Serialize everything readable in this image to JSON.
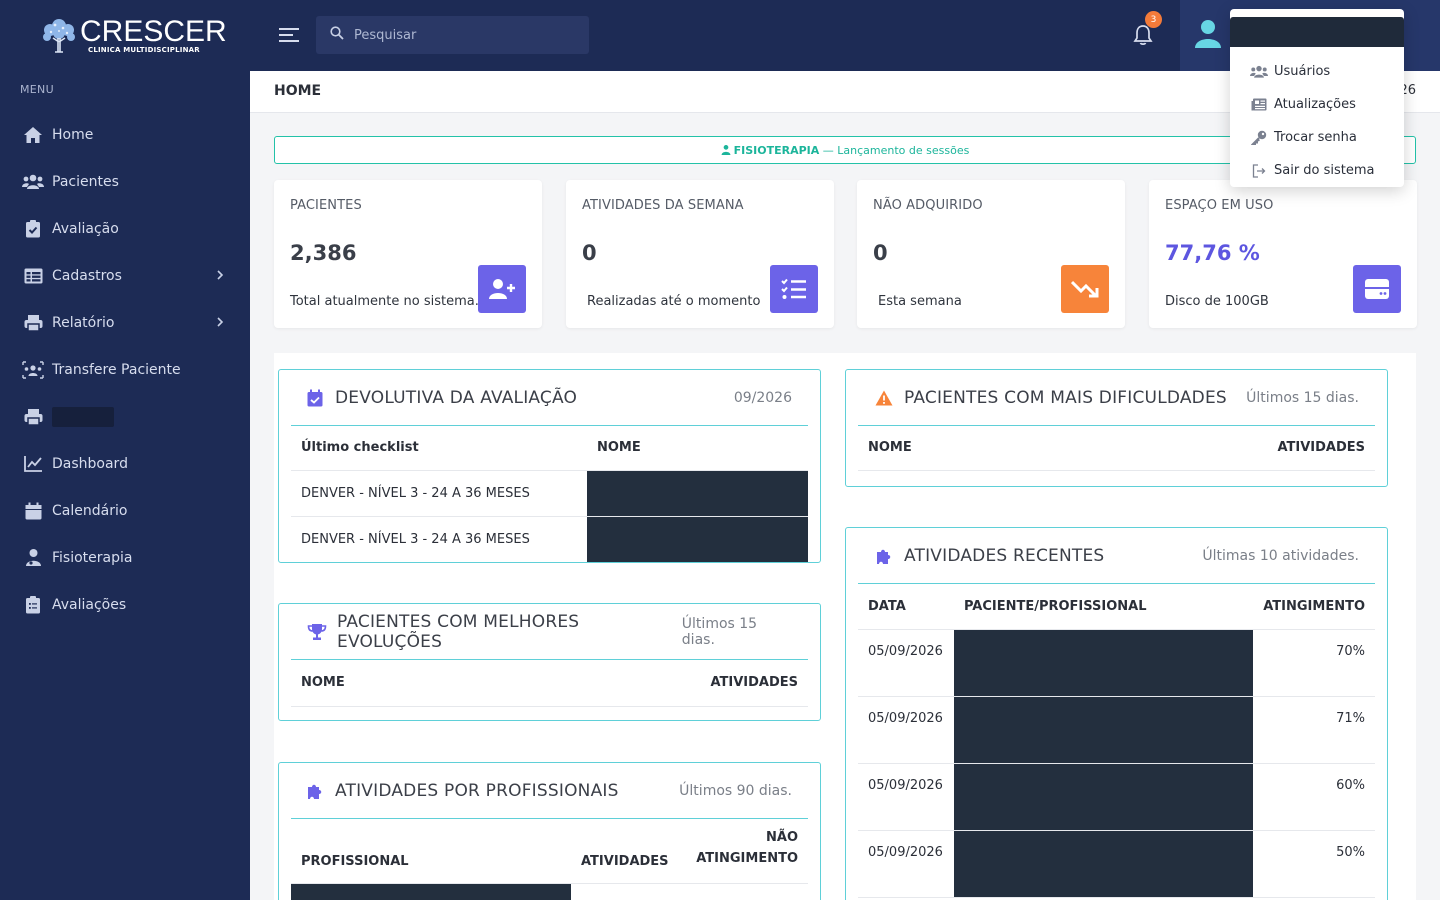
{
  "brand": {
    "name": "CRESCER",
    "subtitle": "CLINICA MULTIDISCIPLINAR"
  },
  "sidebar": {
    "menu_title": "MENU",
    "items": [
      {
        "label": "Home",
        "icon": "home-icon"
      },
      {
        "label": "Pacientes",
        "icon": "users-icon"
      },
      {
        "label": "Avaliação",
        "icon": "clipboard-check-icon"
      },
      {
        "label": "Cadastros",
        "icon": "table-icon",
        "has_submenu": true
      },
      {
        "label": "Relatório",
        "icon": "printer-icon",
        "has_submenu": true
      },
      {
        "label": "Transfere Paciente",
        "icon": "users-transfer-icon"
      },
      {
        "label": "",
        "icon": "printer-icon",
        "redacted": true
      },
      {
        "label": "Dashboard",
        "icon": "line-chart-icon"
      },
      {
        "label": "Calendário",
        "icon": "calendar-icon"
      },
      {
        "label": "Fisioterapia",
        "icon": "user-medical-icon"
      },
      {
        "label": "Avaliações",
        "icon": "clipboard-list-icon"
      }
    ]
  },
  "topbar": {
    "search_placeholder": "Pesquisar",
    "notifications_count": "3"
  },
  "user_menu": {
    "items": [
      {
        "label": "Usuários",
        "icon": "users-icon"
      },
      {
        "label": "Atualizações",
        "icon": "newspaper-icon"
      },
      {
        "label": "Trocar senha",
        "icon": "key-icon"
      },
      {
        "label": "Sair do sistema",
        "icon": "sign-out-icon"
      }
    ]
  },
  "page": {
    "title": "HOME",
    "date_tail": "26"
  },
  "banner": {
    "strong": "FISIOTERAPIA",
    "text": " — Lançamento de sessões"
  },
  "stats": [
    {
      "title": "PACIENTES",
      "value": "2,386",
      "desc": "Total atualmente no sistema.",
      "icon": "user-plus-icon",
      "color": "#6c63e8"
    },
    {
      "title": "ATIVIDADES DA SEMANA",
      "value": "0",
      "desc": "Realizadas até o momento",
      "icon": "checklist-icon",
      "color": "#6c63e8"
    },
    {
      "title": "NÃO ADQUIRIDO",
      "value": "0",
      "desc": "Esta semana",
      "icon": "trend-down-icon",
      "color": "#f7843a"
    },
    {
      "title": "ESPAÇO EM USO",
      "value": "77,76 %",
      "desc": "Disco de 100GB",
      "icon": "hard-drive-icon",
      "color": "#6c63e8"
    }
  ],
  "devolutiva": {
    "title": "DEVOLUTIVA DA AVALIAÇÃO",
    "right": "09/2026",
    "headers": [
      "Último checklist",
      "NOME"
    ],
    "rows": [
      [
        "DENVER - NÍVEL 3 - 24 A 36 MESES",
        ""
      ],
      [
        "DENVER - NÍVEL 3 - 24 A 36 MESES",
        ""
      ]
    ]
  },
  "melhores": {
    "title": "PACIENTES COM MELHORES EVOLUÇÕES",
    "right": "Últimos 15 dias.",
    "headers": [
      "NOME",
      "ATIVIDADES"
    ]
  },
  "profissionais": {
    "title": "ATIVIDADES POR PROFISSIONAIS",
    "right": "Últimos 90 dias.",
    "headers": [
      "PROFISSIONAL",
      "ATIVIDADES",
      "NÃO",
      "ATINGIMENTO"
    ]
  },
  "dificuldades": {
    "title": "PACIENTES COM MAIS DIFICULDADES",
    "right": "Últimos 15 dias.",
    "headers": [
      "NOME",
      "ATIVIDADES"
    ]
  },
  "recentes": {
    "title": "ATIVIDADES RECENTES",
    "right": "Últimas 10 atividades.",
    "headers": [
      "DATA",
      "PACIENTE/PROFISSIONAL",
      "ATINGIMENTO"
    ],
    "rows": [
      {
        "date": "05/09/2026",
        "value": "70%"
      },
      {
        "date": "05/09/2026",
        "value": "71%"
      },
      {
        "date": "05/09/2026",
        "value": "60%"
      },
      {
        "date": "05/09/2026",
        "value": "50%"
      }
    ]
  },
  "colors": {
    "sidebar": "#1d2b55",
    "accent_purple": "#6c63e8",
    "accent_orange": "#f7843a",
    "accent_teal": "#23c2a8",
    "card_border": "#5fd0d8"
  }
}
